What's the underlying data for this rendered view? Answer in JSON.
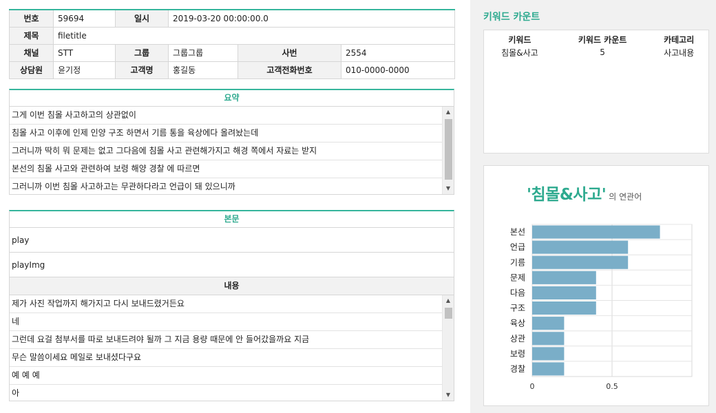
{
  "info": {
    "labels": {
      "no": "번호",
      "datetime": "일시",
      "title": "제목",
      "channel": "채널",
      "group": "그룹",
      "emp_no": "사번",
      "agent": "상담원",
      "customer": "고객명",
      "phone": "고객전화번호"
    },
    "values": {
      "no": "59694",
      "datetime": "2019-03-20 00:00:00.0",
      "title": "filetitle",
      "channel": "STT",
      "group": "그룹그룹",
      "emp_no": "2554",
      "agent": "윤기정",
      "customer": "홍길동",
      "phone": "010-0000-0000"
    }
  },
  "summary": {
    "header": "요약",
    "lines": [
      "그게 이번 침몰 사고하고의 상관없이",
      "침몰 사고 이후에 인제 인양 구조 하면서 기름 통을 육상에다 올려놨는데",
      "그러니까 딱히 뭐 문제는 없고 그다음에 침몰 사고 관련해가지고 해경 쪽에서 자료는 받지",
      "본선의 침몰 사고와 관련하여 보령 해양 경찰 에 따르면",
      "그러니까 이번 침몰 사고하고는 무관하다라고 언급이 돼 있으니까"
    ]
  },
  "body": {
    "header": "본문",
    "play": "play",
    "play_img": "playImg",
    "content_header": "내용",
    "lines": [
      "제가 사진 작업까지 해가지고 다시 보내드렸거든요",
      "네",
      "그런데 요걸 첨부서를 따로 보내드려야 될까 그 지금 용량 때문에 안 들어갔을까요 지금",
      "무슨 말씀이세요 메일로 보내셨다구요",
      "예 예 예",
      "아"
    ]
  },
  "keyword_count": {
    "title": "키워드 카운트",
    "columns": [
      "키워드",
      "키워드 카운트",
      "카테고리"
    ],
    "rows": [
      {
        "keyword": "침몰&사고",
        "count": "5",
        "category": "사고내용"
      }
    ]
  },
  "related": {
    "keyword": "'침몰&사고'",
    "suffix": "의 연관어"
  },
  "chart_data": {
    "type": "bar",
    "orientation": "horizontal",
    "categories": [
      "본선",
      "언급",
      "기름",
      "문제",
      "다음",
      "구조",
      "육상",
      "상관",
      "보령",
      "경찰"
    ],
    "values": [
      0.8,
      0.6,
      0.6,
      0.4,
      0.4,
      0.4,
      0.2,
      0.2,
      0.2,
      0.2
    ],
    "xlim": [
      0,
      1.0
    ],
    "xticks": [
      "0",
      "0.5"
    ],
    "grid": true,
    "bar_color": "#7aaec8",
    "title": "",
    "xlabel": "",
    "ylabel": ""
  },
  "colors": {
    "accent": "#35b59c",
    "accent_text": "#2eaa8f"
  }
}
